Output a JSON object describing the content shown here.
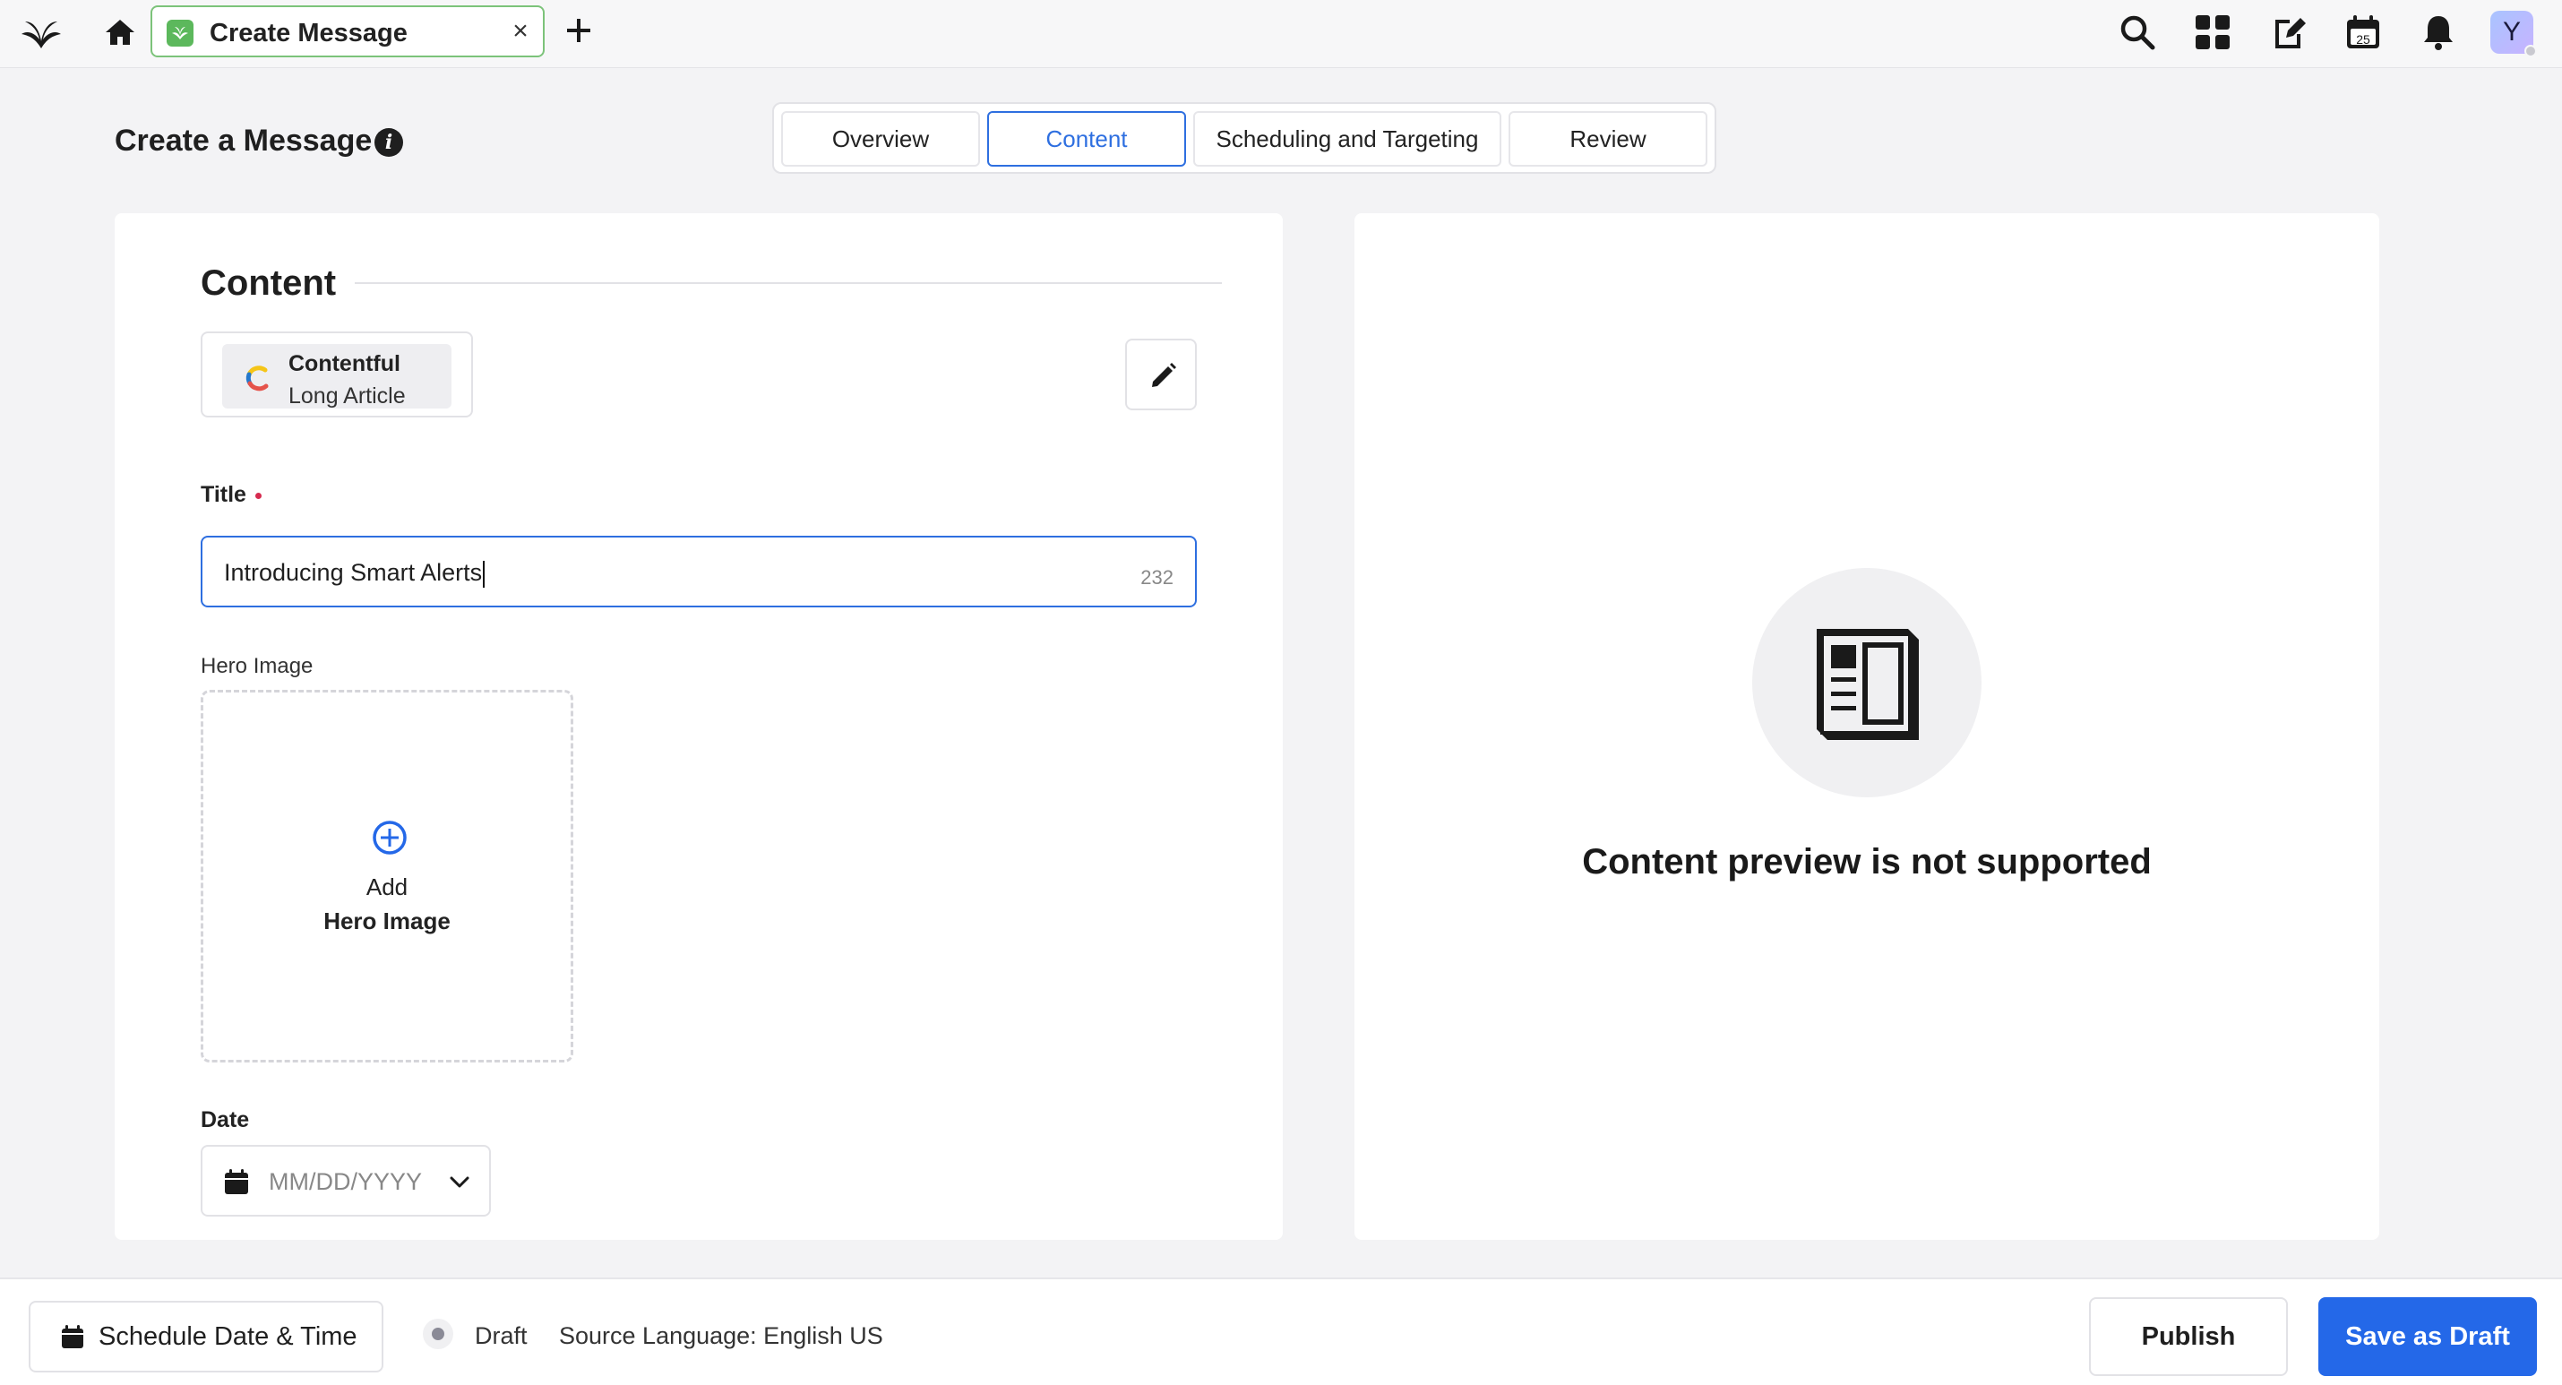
{
  "topbar": {
    "tab_title": "Create Message",
    "tab_close": "×",
    "avatar_initial": "Y",
    "calendar_day": "25",
    "icons": [
      "app-logo-icon",
      "home-icon",
      "message-tab-icon",
      "close-icon",
      "plus-icon",
      "search-icon",
      "grid-icon",
      "compose-icon",
      "calendar-icon",
      "bell-icon"
    ]
  },
  "header": {
    "title": "Create a Message",
    "info_glyph": "i"
  },
  "steps": [
    {
      "label": "Overview",
      "active": false
    },
    {
      "label": "Content",
      "active": true
    },
    {
      "label": "Scheduling and Targeting",
      "active": false
    },
    {
      "label": "Review",
      "active": false
    }
  ],
  "content": {
    "section_title": "Content",
    "source": {
      "name": "Contentful",
      "type": "Long Article"
    },
    "title_field": {
      "label": "Title",
      "value": "Introducing Smart Alerts",
      "char_count": "232"
    },
    "hero_image": {
      "label": "Hero Image",
      "add_line1": "Add",
      "add_line2": "Hero Image"
    },
    "date_field": {
      "label": "Date",
      "placeholder": "MM/DD/YYYY"
    }
  },
  "preview": {
    "message": "Content preview is not supported"
  },
  "footer": {
    "schedule_label": "Schedule Date & Time",
    "status": "Draft",
    "source_language": "Source Language: English US",
    "publish_label": "Publish",
    "save_draft_label": "Save as Draft"
  },
  "colors": {
    "accent": "#2468e8",
    "active_tab_border": "#7cc37a",
    "required": "#d62b4f"
  }
}
